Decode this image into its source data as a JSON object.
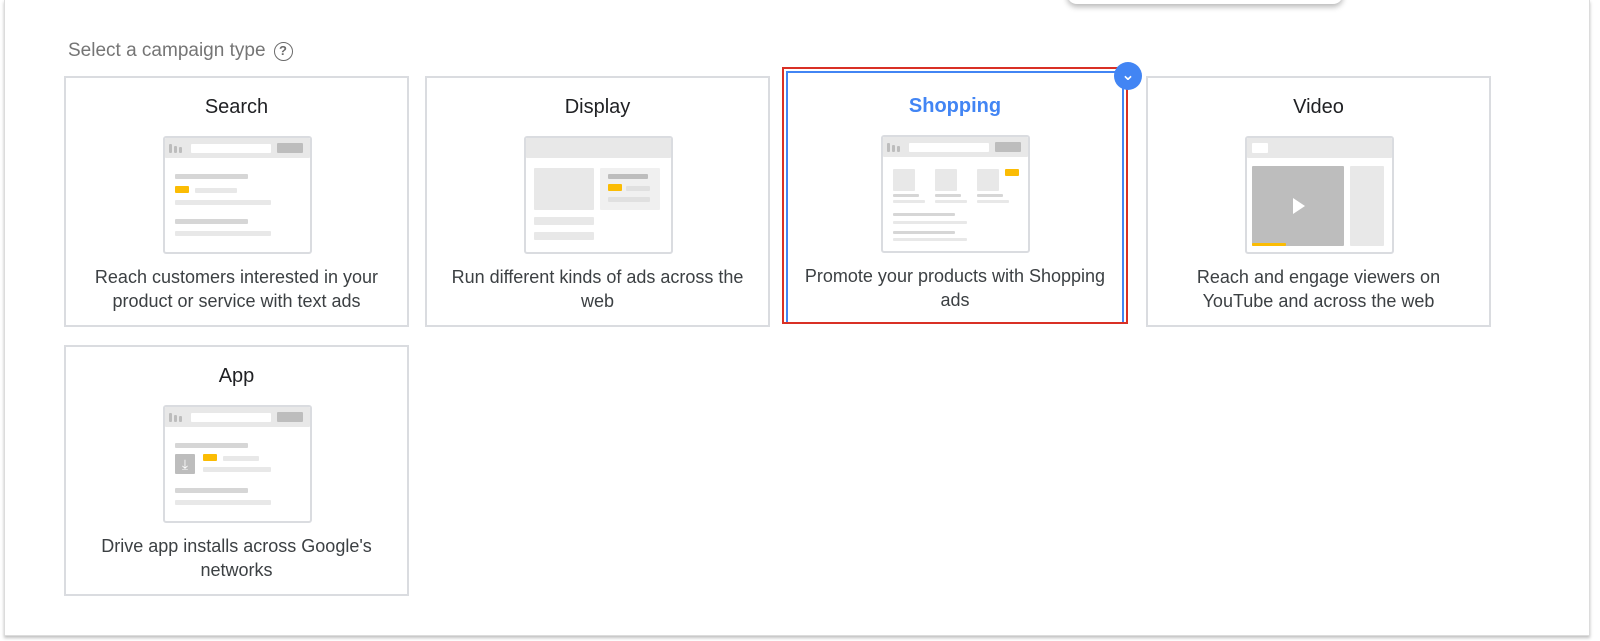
{
  "heading": {
    "label": "Select a campaign type",
    "help_icon": "?"
  },
  "cards": [
    {
      "id": "search",
      "title": "Search",
      "description": "Reach customers interested in your product or service with text ads",
      "selected": false
    },
    {
      "id": "display",
      "title": "Display",
      "description": "Run different kinds of ads across the web",
      "selected": false
    },
    {
      "id": "shopping",
      "title": "Shopping",
      "description": "Promote your products with Shopping ads",
      "selected": true
    },
    {
      "id": "video",
      "title": "Video",
      "description": "Reach and engage viewers on YouTube and across the web",
      "selected": false
    },
    {
      "id": "app",
      "title": "App",
      "description": "Drive app installs across Google's networks",
      "selected": false
    }
  ],
  "colors": {
    "accent_blue": "#4285f4",
    "highlight_red": "#d93025",
    "ad_yellow": "#fbbc04"
  },
  "icons": {
    "help": "help-circle-icon",
    "selected": "chevron-down-check-icon",
    "search_glyph": "⌕",
    "play": "play-icon",
    "download": "download-icon"
  }
}
